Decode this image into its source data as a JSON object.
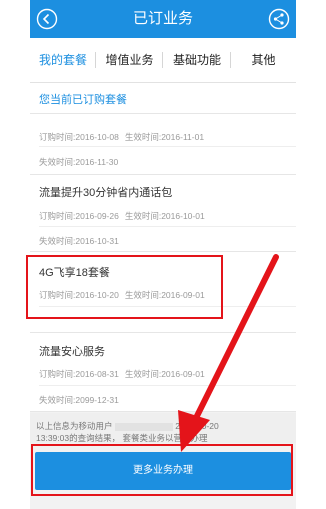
{
  "header": {
    "title": "已订业务"
  },
  "tabs": [
    {
      "label": "我的套餐"
    },
    {
      "label": "增值业务"
    },
    {
      "label": "基础功能"
    },
    {
      "label": "其他"
    }
  ],
  "section_title": "您当前已订购套餐",
  "packages": [
    {
      "name": "",
      "order_time": "订购时间:2016-10-08",
      "effective_time": "生效时间:2016-11-01",
      "expire_time": "失效时间:2016-11-30"
    },
    {
      "name": "流量提升30分钟省内通话包",
      "order_time": "订购时间:2016-09-26",
      "effective_time": "生效时间:2016-10-01",
      "expire_time": "失效时间:2016-10-31"
    },
    {
      "name": "4G飞享18套餐",
      "order_time": "订购时间:2016-10-20",
      "effective_time": "生效时间:2016-09-01",
      "expire_time": ""
    },
    {
      "name": "流量安心服务",
      "order_time": "订购时间:2016-08-31",
      "effective_time": "生效时间:2016-09-01",
      "expire_time": "失效时间:2099-12-31"
    }
  ],
  "footer_note": {
    "line1_a": "以上信息为移动用户",
    "line1_b": "2016-10-20",
    "line2_a": "13:39:03的查询结果，",
    "line2_b": "套餐类业务以营业办理"
  },
  "more_button": "更多业务办理",
  "colors": {
    "brand": "#1c8fe0",
    "highlight": "#e4141a"
  }
}
